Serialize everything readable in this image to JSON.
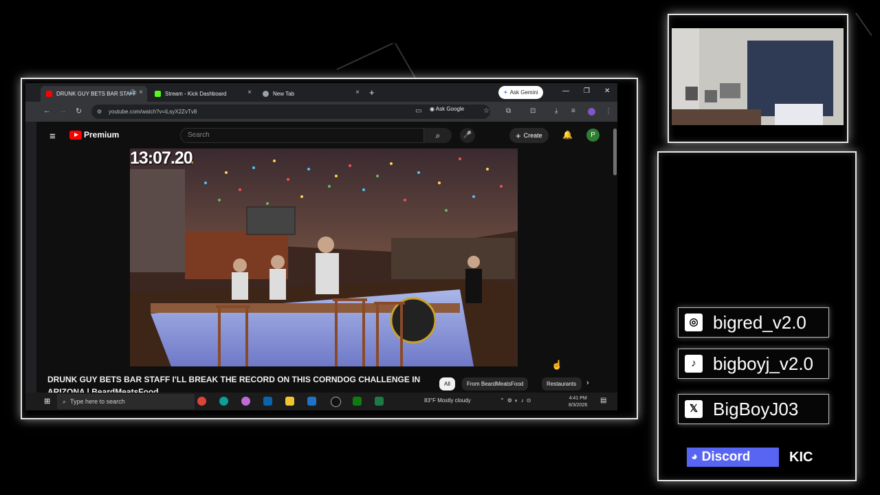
{
  "browser": {
    "tabs": [
      {
        "label": "DRUNK GUY BETS BAR STAFF",
        "favicon_color": "#ff0000",
        "active": true
      },
      {
        "label": "Stream - Kick Dashboard",
        "favicon_color": "#53fc18",
        "active": false
      },
      {
        "label": "New Tab",
        "favicon_color": "#9aa0a6",
        "active": false
      }
    ],
    "ask_gemini": "Ask Gemini",
    "url": "youtube.com/watch?v=iLsyX2ZvTv8",
    "ask_google": "Ask Google"
  },
  "youtube": {
    "brand": "Premium",
    "search_placeholder": "Search",
    "create_label": "Create",
    "avatar_letter": "P",
    "timer": "13:07.20",
    "video_title": "DRUNK GUY BETS BAR STAFF I'LL BREAK THE RECORD ON THIS CORNDOG CHALLENGE IN ARIZONA | BeardMeatsFood",
    "chips": [
      "All",
      "From BeardMeatsFood",
      "Restaurants"
    ]
  },
  "taskbar": {
    "search_placeholder": "Type here to search",
    "weather": "83°F  Mostly cloudy",
    "time": "4:41 PM",
    "date": "8/3/2026"
  },
  "socials": {
    "instagram": "bigred_v2.0",
    "tiktok": "bigboyj_v2.0",
    "x": "BigBoyJ03",
    "discord_label": "Discord",
    "kick_partial": "KIC"
  },
  "colors": {
    "youtube_red": "#ff0000",
    "discord_blurple": "#5865f2",
    "kick_green": "#53fc18"
  }
}
